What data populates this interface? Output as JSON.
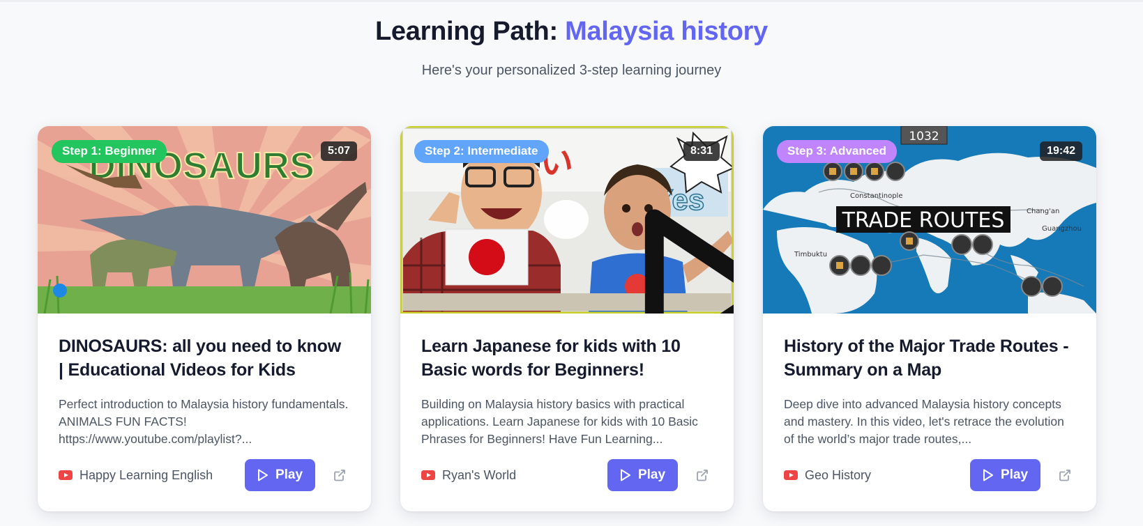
{
  "header": {
    "title_prefix": "Learning Path:",
    "title_topic": "Malaysia history",
    "subtitle": "Here's your personalized 3-step learning journey"
  },
  "colors": {
    "accent": "#6366f1",
    "beginner": "#22c55e",
    "intermediate": "#60a5fa",
    "advanced": "#c084fc",
    "youtube": "#ef4444"
  },
  "cards": [
    {
      "step": "Step 1: Beginner",
      "duration": "5:07",
      "thumb_text": "DINOSAURS",
      "title": "DINOSAURS: all you need to know | Educational Videos for Kids",
      "description": "Perfect introduction to Malaysia history fundamentals. ANIMALS FUN FACTS! https://www.youtube.com/playlist?...",
      "channel": "Happy Learning English",
      "play_label": "Play",
      "icons": [
        "youtube-icon",
        "play-icon",
        "external-link-icon"
      ]
    },
    {
      "step": "Step 2: Intermediate",
      "duration": "8:31",
      "thumb_text_1": "はい",
      "thumb_text_2": "Yes",
      "title": "Learn Japanese for kids with 10 Basic words for Beginners!",
      "description": "Building on Malaysia history basics with practical applications. Learn Japanese for kids with 10 Basic Phrases for Beginners! Have Fun Learning...",
      "channel": "Ryan's World",
      "play_label": "Play",
      "icons": [
        "youtube-icon",
        "play-icon",
        "external-link-icon"
      ]
    },
    {
      "step": "Step 3: Advanced",
      "duration": "19:42",
      "thumb_text": "TRADE ROUTES",
      "thumb_year": "1032",
      "map_labels": [
        "Timbuktu",
        "Constantinople",
        "Chang'an",
        "Guangzhou"
      ],
      "title": "History of the Major Trade Routes - Summary on a Map",
      "description": "Deep dive into advanced Malaysia history concepts and mastery. In this video, let's retrace the evolution of the world’s major trade routes,...",
      "channel": "Geo History",
      "play_label": "Play",
      "icons": [
        "youtube-icon",
        "play-icon",
        "external-link-icon"
      ]
    }
  ]
}
